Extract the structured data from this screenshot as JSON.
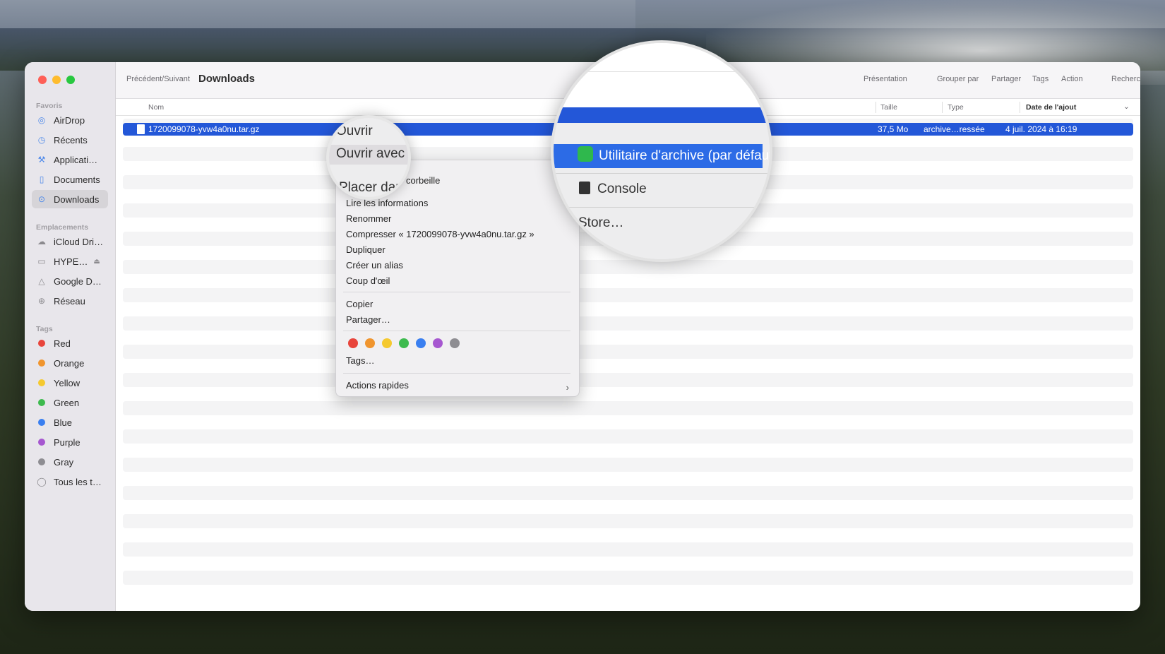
{
  "window": {
    "nav_label": "Précédent/Suivant",
    "title": "Downloads",
    "toolbar": [
      "Présentation",
      "Grouper par",
      "Partager",
      "Tags",
      "Action",
      "Rechercher"
    ]
  },
  "sidebar": {
    "favoris_title": "Favoris",
    "favoris": [
      {
        "label": "AirDrop",
        "icon": "airdrop-icon"
      },
      {
        "label": "Récents",
        "icon": "clock-icon"
      },
      {
        "label": "Applicati…",
        "icon": "applications-icon"
      },
      {
        "label": "Documents",
        "icon": "document-icon"
      },
      {
        "label": "Downloads",
        "icon": "download-icon",
        "active": true
      }
    ],
    "emplacements_title": "Emplacements",
    "emplacements": [
      {
        "label": "iCloud Dri…",
        "icon": "cloud-icon"
      },
      {
        "label": "HYPE…",
        "icon": "drive-icon"
      },
      {
        "label": "Google D…",
        "icon": "google-drive-icon"
      },
      {
        "label": "Réseau",
        "icon": "network-icon"
      }
    ],
    "tags_title": "Tags",
    "tags": [
      {
        "label": "Red",
        "color": "#e8453c"
      },
      {
        "label": "Orange",
        "color": "#f0952e"
      },
      {
        "label": "Yellow",
        "color": "#f5c92f"
      },
      {
        "label": "Green",
        "color": "#3dba4e"
      },
      {
        "label": "Blue",
        "color": "#3a7ff0"
      },
      {
        "label": "Purple",
        "color": "#a657d0"
      },
      {
        "label": "Gray",
        "color": "#8e8d92"
      },
      {
        "label": "Tous les t…",
        "color": ""
      }
    ]
  },
  "columns": {
    "name": "Nom",
    "size": "Taille",
    "type": "Type",
    "date": "Date de l'ajout"
  },
  "file": {
    "name": "1720099078-yvw4a0nu.tar.gz",
    "size": "37,5 Mo",
    "type": "archive…ressée",
    "date": "4 juil. 2024 à 16:19"
  },
  "context_menu": {
    "trash_fragment": "corbeille",
    "items": [
      "Lire les informations",
      "Renommer",
      "Compresser « 1720099078-yvw4a0nu.tar.gz »",
      "Dupliquer",
      "Créer un alias",
      "Coup d'œil"
    ],
    "copy": "Copier",
    "share": "Partager…",
    "tag_colors": [
      "#e8453c",
      "#f0952e",
      "#f5c92f",
      "#3dba4e",
      "#3a7ff0",
      "#a657d0",
      "#8e8d92"
    ],
    "tags": "Tags…",
    "quick_actions": "Actions rapides"
  },
  "magnifier_left": {
    "open": "Ouvrir",
    "open_with": "Ouvrir avec",
    "move_to": "Placer dar"
  },
  "magnifier_right": {
    "default_app": "Utilitaire d'archive (par défaut)",
    "app2": "Console",
    "app3": "Store…"
  }
}
